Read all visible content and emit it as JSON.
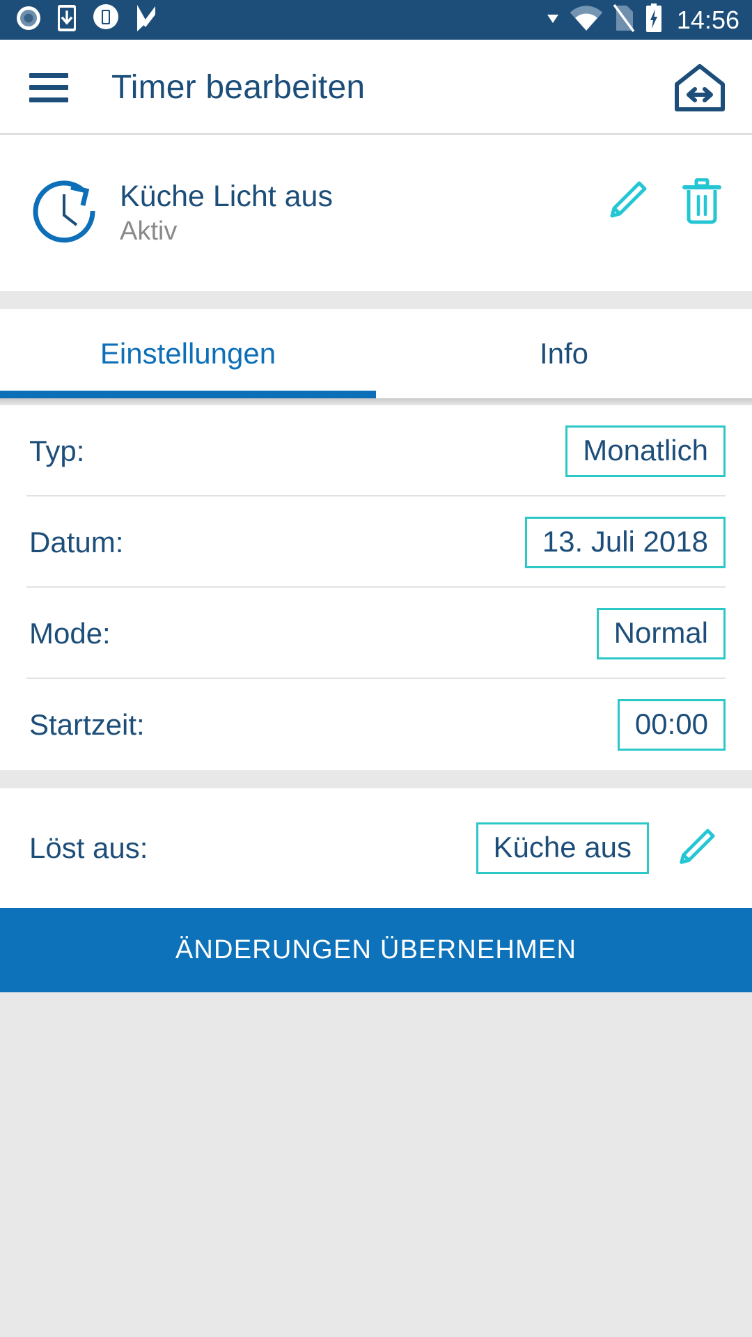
{
  "statusbar": {
    "time": "14:56",
    "left_icons": [
      "record-circle-icon",
      "phone-download-icon",
      "phone-circle-icon",
      "checkmark-flag-icon"
    ],
    "right_icons": [
      "dropdown-caret-icon",
      "wifi-icon",
      "sim-off-icon",
      "battery-charging-icon"
    ],
    "background": "#1d4e79"
  },
  "appbar": {
    "menu_icon": "hamburger-menu-icon",
    "title": "Timer bearbeiten",
    "action_icon": "home-transfer-icon",
    "title_color": "#1d4e79"
  },
  "timer": {
    "icon": "clock-rotate-icon",
    "name": "Küche Licht aus",
    "state": "Aktiv",
    "edit_icon": "pencil-icon",
    "delete_icon": "trash-icon",
    "accent_color": "#24c6d4"
  },
  "tabs": {
    "items": [
      {
        "label": "Einstellungen",
        "active": true
      },
      {
        "label": "Info",
        "active": false
      }
    ],
    "active_color": "#0d6fb8",
    "inactive_color": "#1d4e79"
  },
  "settings": {
    "rows": [
      {
        "label": "Typ:",
        "value": "Monatlich"
      },
      {
        "label": "Datum:",
        "value": "13. Juli 2018"
      },
      {
        "label": "Mode:",
        "value": "Normal"
      },
      {
        "label": "Startzeit:",
        "value": "00:00"
      }
    ]
  },
  "trigger": {
    "label": "Löst aus:",
    "value": "Küche aus",
    "edit_icon": "pencil-icon"
  },
  "apply": {
    "label": "ÄNDERUNGEN ÜBERNEHMEN",
    "color": "#0d72b9"
  }
}
